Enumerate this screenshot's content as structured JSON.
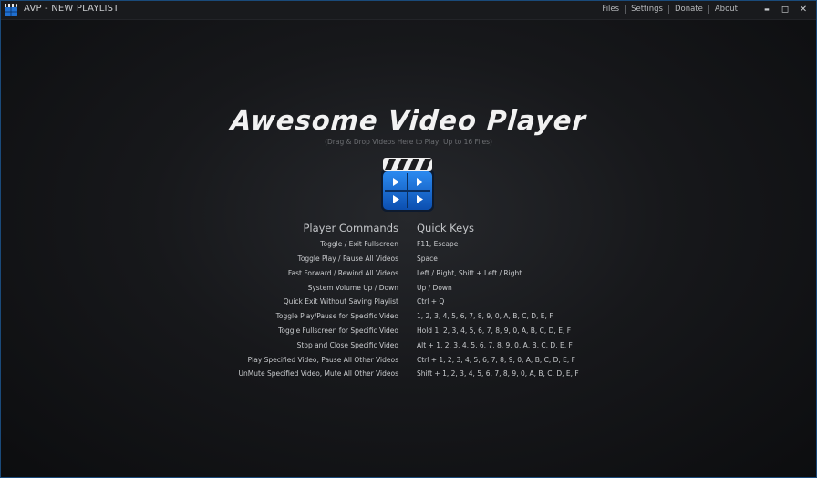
{
  "window": {
    "title": "AVP - NEW PLAYLIST",
    "menu": [
      "Files",
      "Settings",
      "Donate",
      "About"
    ],
    "controls": {
      "minimize": "▬",
      "maximize": "◻",
      "close": "✕"
    }
  },
  "hero": {
    "title": "Awesome Video Player",
    "subtitle": "(Drag & Drop Videos Here to Play, Up to 16 Files)"
  },
  "commands": {
    "header_left": "Player Commands",
    "header_right": "Quick Keys",
    "rows": [
      {
        "command": "Toggle / Exit Fullscreen",
        "keys": "F11, Escape"
      },
      {
        "command": "Toggle Play / Pause All Videos",
        "keys": "Space"
      },
      {
        "command": "Fast Forward / Rewind All Videos",
        "keys": "Left / Right, Shift + Left / Right"
      },
      {
        "command": "System Volume Up / Down",
        "keys": "Up / Down"
      },
      {
        "command": "Quick Exit Without Saving Playlist",
        "keys": "Ctrl + Q"
      },
      {
        "command": "Toggle Play/Pause for Specific Video",
        "keys": "1, 2, 3, 4, 5, 6, 7, 8, 9, 0, A, B, C, D, E, F"
      },
      {
        "command": "Toggle Fullscreen for Specific Video",
        "keys": "Hold 1, 2, 3, 4, 5, 6, 7, 8, 9, 0, A, B, C, D, E, F"
      },
      {
        "command": "Stop and Close Specific Video",
        "keys": "Alt + 1, 2, 3, 4, 5, 6, 7, 8, 9, 0, A, B, C, D, E, F"
      },
      {
        "command": "Play Specified Video, Pause All Other Videos",
        "keys": "Ctrl + 1, 2, 3, 4, 5, 6, 7, 8, 9, 0, A, B, C, D, E, F"
      },
      {
        "command": "UnMute Specified Video, Mute All Other Videos",
        "keys": "Shift + 1, 2, 3, 4, 5, 6, 7, 8, 9, 0, A, B, C, D, E, F"
      }
    ]
  },
  "colors": {
    "accent": "#1e7be0",
    "background": "#17181b",
    "text": "#c8cacd"
  }
}
